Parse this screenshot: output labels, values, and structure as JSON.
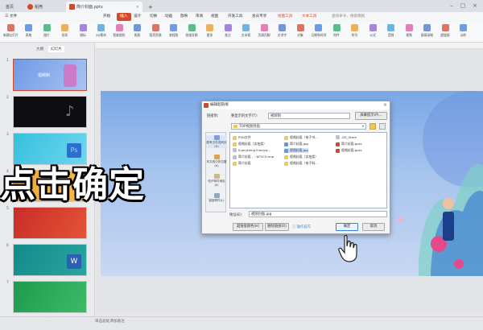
{
  "titlebar": {
    "tabs": [
      {
        "label": "首页"
      },
      {
        "label": "稻壳"
      },
      {
        "label": "简介封面.pptx"
      }
    ],
    "new_tab": "+"
  },
  "menubar": {
    "file": "三 文件",
    "items": [
      "开始",
      "插入",
      "设计",
      "切换",
      "动画",
      "放映",
      "审阅",
      "视图",
      "开发工具",
      "会员专享"
    ],
    "active": "插入",
    "right_items": [
      "绘图工具",
      "文本工具"
    ],
    "search": "查找命令、搜索模板"
  },
  "ribbon": {
    "buttons": [
      "新建幻灯片",
      "表格",
      "图片",
      "形状",
      "图标",
      "3D素材",
      "智能图形",
      "图表",
      "稻壳资源",
      "流程图",
      "思维导图",
      "更多",
      "批注",
      "文本框",
      "页眉页脚",
      "艺术字",
      "对象",
      "日期和时间",
      "附件",
      "符号",
      "公式",
      "音频",
      "视频",
      "屏幕录制",
      "超链接",
      "动作"
    ]
  },
  "leftpanel": {
    "tabs": [
      "大纲",
      "幻灯片"
    ],
    "active_tab": "幻灯片",
    "slides": [
      {
        "num": "1",
        "text": "视频制"
      },
      {
        "num": "2",
        "text": ""
      },
      {
        "num": "3",
        "text": ""
      },
      {
        "num": "4",
        "text": ""
      },
      {
        "num": "5",
        "text": ""
      },
      {
        "num": "6",
        "text": ""
      },
      {
        "num": "7",
        "text": ""
      }
    ],
    "add": "+"
  },
  "dialog": {
    "title": "编辑超链接",
    "close": "×",
    "link_to_label": "链接到:",
    "display_text_label": "要显示的文字(T):",
    "display_text_value": "视频制",
    "screen_tip_button": "屏幕提示(P)...",
    "places": [
      "原有文件或网页(X)",
      "本文档中的位置(A)",
      "电子邮件地址(E)",
      "链接附件(L)"
    ],
    "folder_label": "",
    "folder_value": "TOP视频封面",
    "files": [
      {
        "name": "PSD文件",
        "kind": "folder"
      },
      {
        "name": "视频封面（实拍类）",
        "kind": "folder"
      },
      {
        "name": "Everything Everyw...",
        "kind": "doc"
      },
      {
        "name": "简介封面 - ~$F5C5.tmp",
        "kind": "doc"
      },
      {
        "name": "简介封面",
        "kind": "folder"
      },
      {
        "name": "视频封面（电子书...",
        "kind": "folder"
      },
      {
        "name": "简介封面.jpg",
        "kind": "img"
      },
      {
        "name": "视频封面.jpg",
        "kind": "img",
        "selected": true
      },
      {
        "name": "视频封面（实拍类）",
        "kind": "folder"
      },
      {
        "name": "视频封面（电子科...",
        "kind": "folder"
      },
      {
        "name": ".DS_Store",
        "kind": "doc"
      },
      {
        "name": "简介封面.pptx",
        "kind": "ppt"
      },
      {
        "name": "视频封面.pptx",
        "kind": "ppt"
      }
    ],
    "address_label": "地址(E):",
    "address_value": "视频封面.jpg",
    "link_attachment_button": "超链接颜色(H)",
    "remove_link_button": "删除链接(R)",
    "help": "操作技巧",
    "ok": "确定",
    "cancel": "取消"
  },
  "caption": "点击确定",
  "statusbar": {
    "note_placeholder": "单击此处添加备注"
  },
  "colors": {
    "accent": "#d2492c",
    "dialog_primary": "#3c7fd9",
    "slide_bg": "#9ab9ec"
  }
}
